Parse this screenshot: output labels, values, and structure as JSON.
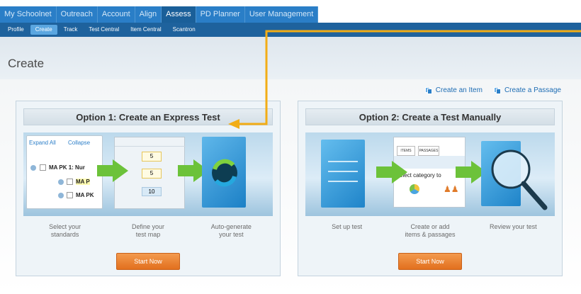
{
  "topnav": {
    "tabs": [
      {
        "label": "My Schoolnet"
      },
      {
        "label": "Outreach"
      },
      {
        "label": "Account"
      },
      {
        "label": "Align"
      },
      {
        "label": "Assess"
      },
      {
        "label": "PD Planner"
      },
      {
        "label": "User Management"
      }
    ],
    "active_tab": "Assess"
  },
  "subnav": {
    "items": [
      {
        "label": "Profile"
      },
      {
        "label": "Create"
      },
      {
        "label": "Track"
      },
      {
        "label": "Test Central"
      },
      {
        "label": "Item Central"
      },
      {
        "label": "Scantron"
      }
    ],
    "active_item": "Create"
  },
  "page": {
    "title": "Create"
  },
  "create_links": {
    "item": "Create an Item",
    "passage": "Create a Passage"
  },
  "option1": {
    "title": "Option 1: Create an Express Test",
    "illustration": {
      "expand_all": "Expand All",
      "collapse": "Collapse",
      "tree_root": "MA PK 1: Nur",
      "tree_child_1": "MA P",
      "tree_child_2": "MA PK",
      "map_values": [
        "5",
        "5",
        "10"
      ]
    },
    "steps": [
      "Select your\nstandards",
      "Define your\ntest map",
      "Auto-generate\nyour test"
    ],
    "button": "Start Now"
  },
  "option2": {
    "title": "Option 2: Create a Test Manually",
    "illustration": {
      "tab_items": "ITEMS",
      "tab_passages": "PASSAGES",
      "select_text": "elect category to"
    },
    "steps": [
      "Set up test",
      "Create or add\nitems & passages",
      "Review your test"
    ],
    "button": "Start Now"
  },
  "colors": {
    "nav_blue": "#2a7ec7",
    "subnav_blue": "#1e629d",
    "accent_orange": "#e2701e",
    "callout_line": "#f2ad16",
    "arrow_green": "#6cc23a"
  }
}
